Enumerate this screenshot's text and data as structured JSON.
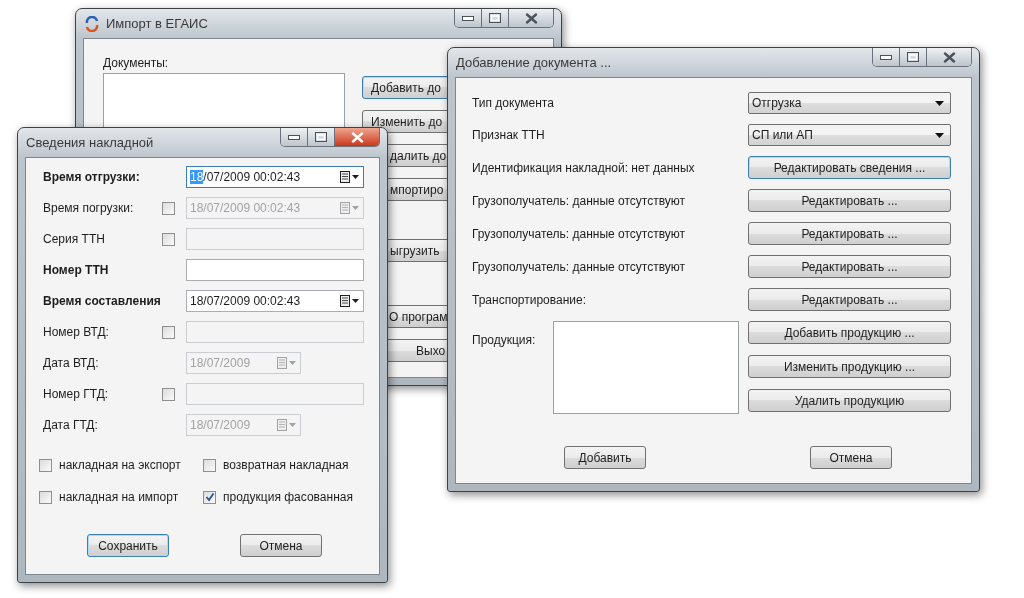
{
  "import_window": {
    "title": "Импорт в ЕГАИС",
    "active": false,
    "documents_label": "Документы:",
    "buttons": [
      {
        "label": "Добавить до",
        "default": true
      },
      {
        "label": "Изменить до",
        "default": false
      },
      {
        "label": "далить до",
        "default": false
      },
      {
        "label": "мпортиро",
        "default": false
      },
      {
        "label": "ыгрузить",
        "default": false
      },
      {
        "label": "О програм",
        "default": false
      },
      {
        "label": "Выхо",
        "default": false
      }
    ]
  },
  "document_window": {
    "title": "Добавление документа ...",
    "active": false,
    "rows": [
      {
        "kind": "combo",
        "label": "Тип документа",
        "value": "Отгрузка"
      },
      {
        "kind": "combo",
        "label": "Признак ТТН",
        "value": "СП или АП"
      },
      {
        "kind": "button",
        "label": "Идентификация накладной: нет данных",
        "button": "Редактировать сведения ...",
        "default": true
      },
      {
        "kind": "button",
        "label": "Грузополучатель: данные отсутствуют",
        "button": "Редактировать ...",
        "default": false
      },
      {
        "kind": "button",
        "label": "Грузополучатель: данные отсутствуют",
        "button": "Редактировать ...",
        "default": false
      },
      {
        "kind": "button",
        "label": "Грузополучатель: данные отсутствуют",
        "button": "Редактировать ...",
        "default": false
      },
      {
        "kind": "button",
        "label": "Транспортирование:",
        "button": "Редактировать ...",
        "default": false
      }
    ],
    "products_label": "Продукция:",
    "product_buttons": [
      {
        "label": "Добавить продукцию ...",
        "default": false
      },
      {
        "label": "Изменить продукцию ...",
        "default": false
      },
      {
        "label": "Удалить продукцию",
        "default": false
      }
    ],
    "footer_buttons": [
      {
        "label": "Добавить",
        "default": false
      },
      {
        "label": "Отмена",
        "default": false
      }
    ]
  },
  "invoice_window": {
    "title": "Сведения накладной",
    "active": true,
    "fields": [
      {
        "label": "Время отгрузки:",
        "required": true,
        "kind": "datetime",
        "selection": "18",
        "value": "/07/2009 00:02:43",
        "disabled": false
      },
      {
        "label": "Время погрузки:",
        "required": false,
        "checkbox": {
          "checked": false
        },
        "kind": "datetime",
        "value": "18/07/2009 00:02:43",
        "disabled": true
      },
      {
        "label": "Серия ТТН",
        "required": false,
        "checkbox": {
          "checked": false
        },
        "kind": "text",
        "disabled": true
      },
      {
        "label": "Номер ТТН",
        "required": true,
        "kind": "text",
        "disabled": false
      },
      {
        "label": "Время составления",
        "required": true,
        "kind": "datetime",
        "value": "18/07/2009 00:02:43",
        "disabled": false
      },
      {
        "label": "Номер ВТД:",
        "required": false,
        "checkbox": {
          "checked": false
        },
        "kind": "text",
        "disabled": true
      },
      {
        "label": "Дата ВТД:",
        "required": false,
        "kind": "date",
        "value": "18/07/2009",
        "disabled": true
      },
      {
        "label": "Номер ГТД:",
        "required": false,
        "checkbox": {
          "checked": false
        },
        "kind": "text",
        "disabled": true
      },
      {
        "label": "Дата ГТД:",
        "required": false,
        "kind": "date",
        "value": "18/07/2009",
        "disabled": true
      }
    ],
    "options": [
      {
        "label": "накладная на экспорт",
        "checked": false
      },
      {
        "label": "возвратная накладная",
        "checked": false
      },
      {
        "label": "накладная на импорт",
        "checked": false
      },
      {
        "label": "продукция фасованная",
        "checked": true
      }
    ],
    "buttons": [
      {
        "label": "Сохранить",
        "default": true
      },
      {
        "label": "Отмена",
        "default": false
      }
    ]
  }
}
